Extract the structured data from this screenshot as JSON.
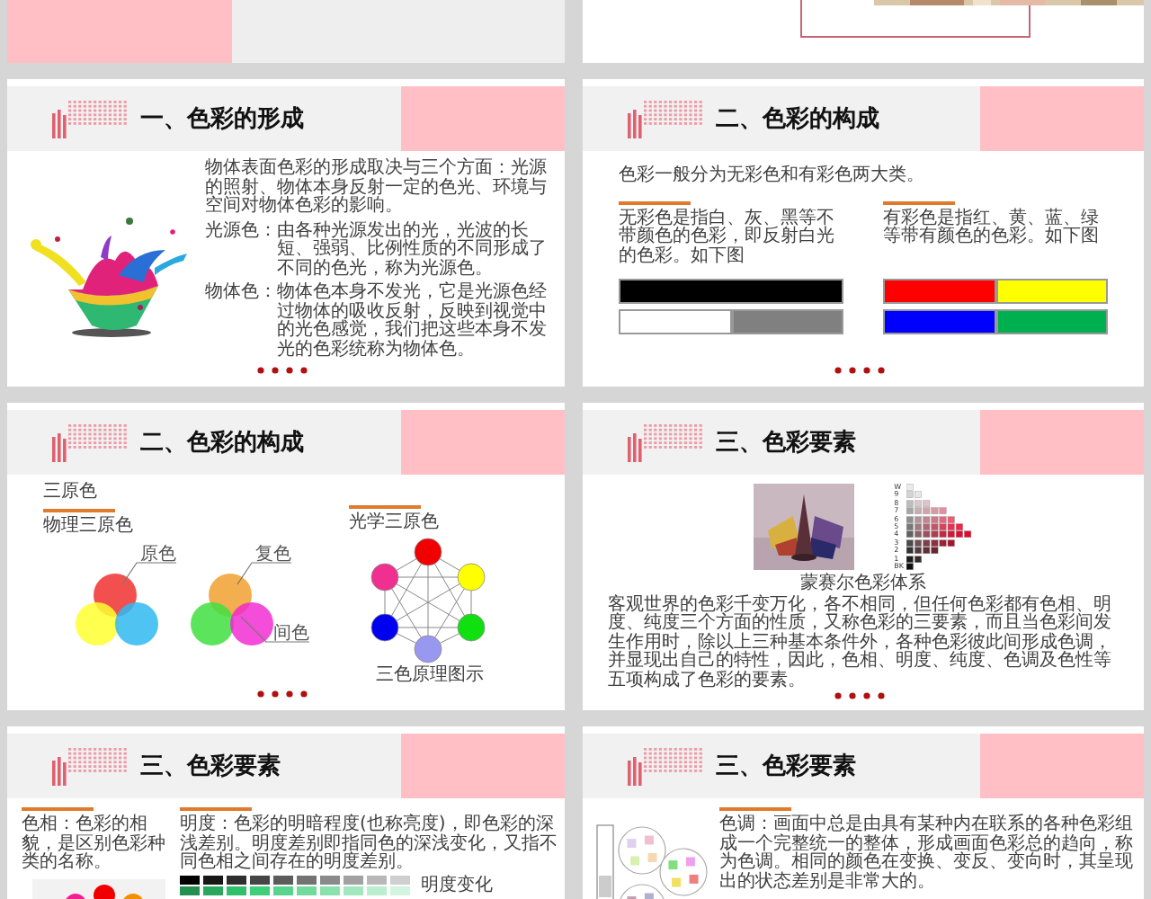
{
  "slides": [
    {
      "kind": "formation",
      "title": "一、色彩的形成",
      "paragraphs": [
        {
          "text": "物体表面色彩的形成取决与三个方面：光源的照射、物体本身反射一定的色光、环境与空间对物体色彩的影响。"
        },
        {
          "term": "光源色：",
          "text": "由各种光源发出的光，光波的长短、强弱、比例性质的不同形成了不同的色光，称为光源色。"
        },
        {
          "term": "物体色：",
          "text": "物体色本身不发光，它是光源色经过物体的吸收反射，反映到视觉中的光色感觉，我们把这些本身不发光的色彩统称为物体色。"
        }
      ]
    },
    {
      "kind": "classes",
      "title": "二、色彩的构成",
      "intro": "色彩一般分为无彩色和有彩色两大类。",
      "groups": [
        {
          "text": "无彩色是指白、灰、黑等不带颜色的色彩，即反射白光的色彩。如下图",
          "swatch_rows": [
            [
              {
                "color": "#000000"
              }
            ],
            [
              {
                "color": "#ffffff"
              },
              {
                "color": "#808080"
              }
            ]
          ]
        },
        {
          "text": "有彩色是指红、黄、蓝、绿等带有颜色的色彩。如下图",
          "swatch_rows": [
            [
              {
                "color": "#ff0000"
              },
              {
                "color": "#ffff00"
              }
            ],
            [
              {
                "color": "#0000ff"
              },
              {
                "color": "#00b050"
              }
            ]
          ]
        }
      ]
    },
    {
      "kind": "primaries",
      "title": "二、色彩的构成",
      "heading": "三原色",
      "physical": {
        "label": "物理三原色",
        "diagram_labels": [
          "原色",
          "复色",
          "间色"
        ]
      },
      "optical": {
        "label": "光学三原色",
        "caption": "三色原理图示"
      }
    },
    {
      "kind": "munsell",
      "title": "三、色彩要素",
      "scale_labels": [
        "W",
        "9",
        "8",
        "7",
        "6",
        "5",
        "4",
        "3",
        "2",
        "1",
        "BK"
      ],
      "caption": "蒙赛尔色彩体系",
      "text": "客观世界的色彩千变万化，各不相同，但任何色彩都有色相、明度、纯度三个方面的性质，又称色彩的三要素，而且当色彩间发生作用时，除以上三种基本条件外，各种色彩彼此间形成色调，并显现出自己的特性，因此，色相、明度、纯度、色调及色性等五项构成了色彩的要素。"
    },
    {
      "kind": "hue-value",
      "title": "三、色彩要素",
      "hue_text": "色相：色彩的相貌，是区别色彩种类的名称。",
      "value_text": "明度：色彩的明暗程度(也称亮度)，即色彩的深浅差别。明度差别即指同色的深浅变化，又指不同色相之间存在的明度差别。",
      "value_label": "明度变化"
    },
    {
      "kind": "tone",
      "title": "三、色彩要素",
      "text": "色调：画面中总是由具有某种内在联系的各种色彩组成一个完整统一的整体，形成画面色彩总的趋向，称为色调。相同的颜色在变换、变反、变向时，其呈现出的状态差别是非常大的。"
    }
  ]
}
